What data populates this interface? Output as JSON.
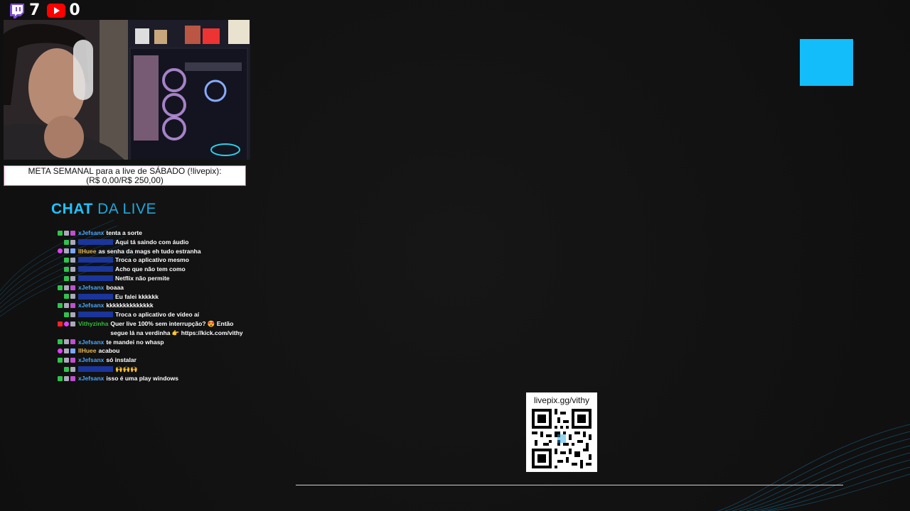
{
  "counters": {
    "twitch": {
      "icon": "twitch-icon",
      "count": "7"
    },
    "youtube": {
      "icon": "youtube-icon",
      "count": "0"
    }
  },
  "goal": {
    "line1": "META SEMANAL para a live de SÁBADO (!livepix):",
    "line2": "(R$ 0,00/R$ 250,00)"
  },
  "chat_title": {
    "part1": "CHAT",
    "part2": "DA LIVE"
  },
  "chat": {
    "messages": [
      {
        "badges": [
          "green",
          "gray",
          "gift"
        ],
        "nick": "xJefsanx",
        "nick_color": "#4aa8ff",
        "text": "tenta a sorte"
      },
      {
        "badges": [
          "green",
          "gray"
        ],
        "nick": "",
        "nick_color": "#1d3fbf",
        "text": "Aqui tá saindo com áudio"
      },
      {
        "badges": [
          "pink",
          "gray",
          "tv"
        ],
        "nick": "IlHuee",
        "nick_color": "#e6b84a",
        "text": "as senha da mags eh tudo estranha"
      },
      {
        "badges": [
          "green",
          "gray"
        ],
        "nick": "",
        "nick_color": "#1d3fbf",
        "text": "Troca o aplicativo mesmo"
      },
      {
        "badges": [
          "green",
          "gray"
        ],
        "nick": "",
        "nick_color": "#1d3fbf",
        "text": "Acho que não tem como"
      },
      {
        "badges": [
          "green",
          "gray"
        ],
        "nick": "",
        "nick_color": "#1d3fbf",
        "text": "Netflix não permite"
      },
      {
        "badges": [
          "green",
          "gray",
          "gift"
        ],
        "nick": "xJefsanx",
        "nick_color": "#4aa8ff",
        "text": "boaaa"
      },
      {
        "badges": [
          "green",
          "gray"
        ],
        "nick": "",
        "nick_color": "#1d3fbf",
        "text": "Eu falei kkkkkk"
      },
      {
        "badges": [
          "green",
          "gray",
          "gift"
        ],
        "nick": "xJefsanx",
        "nick_color": "#4aa8ff",
        "text": "kkkkkkkkkkkkkk"
      },
      {
        "badges": [
          "green",
          "gray"
        ],
        "nick": "",
        "nick_color": "#1d3fbf",
        "text": "Troca o aplicativo de vídeo aí"
      },
      {
        "badges": [
          "red",
          "pink",
          "gray"
        ],
        "nick": "Vithyzinha",
        "nick_color": "#2fbf3a",
        "text": "Quer live 100% sem interrupção? 😍 Então segue lá na verdinha 👉 https://kick.com/vithy"
      },
      {
        "badges": [
          "green",
          "gray",
          "gift"
        ],
        "nick": "xJefsanx",
        "nick_color": "#4aa8ff",
        "text": "te mandei no whasp"
      },
      {
        "badges": [
          "pink",
          "gray",
          "tv"
        ],
        "nick": "IlHuee",
        "nick_color": "#e6b84a",
        "text": "acabou"
      },
      {
        "badges": [
          "green",
          "gray",
          "gift"
        ],
        "nick": "xJefsanx",
        "nick_color": "#4aa8ff",
        "text": "só instalar"
      },
      {
        "badges": [
          "green",
          "gray"
        ],
        "nick": "",
        "nick_color": "#1d3fbf",
        "text": "🙌🙌🙌"
      },
      {
        "badges": [
          "green",
          "gray",
          "gift"
        ],
        "nick": "xJefsanx",
        "nick_color": "#4aa8ff",
        "text": "isso é uma play windows"
      }
    ]
  },
  "qr": {
    "label": "livepix.gg/vithy"
  },
  "colors": {
    "accent": "#12bdfa",
    "title": "#1ec3ff",
    "goal_border": "#ff3d8a"
  }
}
